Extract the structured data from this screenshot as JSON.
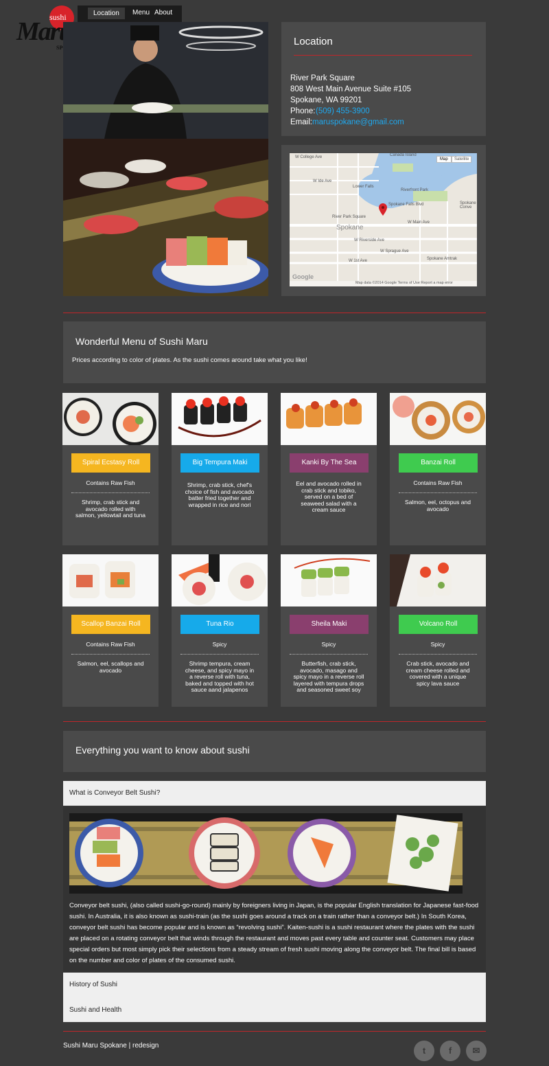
{
  "logo": {
    "sushi": "sushi",
    "maru": "Maru",
    "city": "SPOKANE"
  },
  "nav": {
    "items": [
      "Location",
      "Menu",
      "About"
    ]
  },
  "location": {
    "title": "Location",
    "line1": "River Park Square",
    "line2": "808 West Main Avenue Suite #105",
    "line3": "Spokane, WA 99201",
    "phone_label": "Phone:",
    "phone": "(509) 455-3900",
    "email_label": "Email:",
    "email": "maruspokane@gmail.com"
  },
  "map": {
    "btn_map": "Map",
    "btn_satellite": "Satellite",
    "labels": [
      "W College Ave",
      "Canada Island",
      "W Ide Ave",
      "Lower Falls",
      "Riverfront Park",
      "Spokane Falls Blvd",
      "River Park Square",
      "W Main Ave",
      "Spokane",
      "W Riverside Ave",
      "W Sprague Ave",
      "W 1st Ave",
      "Spokane Amtrak",
      "Spokane Conve"
    ],
    "footer": "Map data ©2014 Google   Terms of Use   Report a map error",
    "google": "Google"
  },
  "menu": {
    "title": "Wonderful Menu of Sushi Maru",
    "subtitle": "Prices according to color of plates. As the sushi comes around take what you like!",
    "items": [
      {
        "name": "Spiral Ecstasy Roll",
        "tag": "Contains Raw Fish",
        "desc": "Shrimp, crab stick and avocado rolled with salmon, yellowtail and tuna",
        "color": "#f5b620"
      },
      {
        "name": "Big Tempura Maki",
        "tag": "",
        "desc": "Shrimp, crab stick, chef's choice of fish and avocado batter fried together and wrapped in rice and nori",
        "color": "#16aaea"
      },
      {
        "name": "Kanki By The Sea",
        "tag": "",
        "desc": "Eel and avocado rolled in crab stick and tobiko, served on a bed of seaweed salad with a cream sauce",
        "color": "#8a3f6e"
      },
      {
        "name": "Banzai Roll",
        "tag": "Contains Raw Fish",
        "desc": "Salmon, eel, octopus and avocado",
        "color": "#3fcb4f"
      },
      {
        "name": "Scallop Banzai Roll",
        "tag": "Contains Raw Fish",
        "desc": "Salmon, eel, scallops and avocado",
        "color": "#f5b620"
      },
      {
        "name": "Tuna Rio",
        "tag": "Spicy",
        "desc": "Shrimp tempura, cream cheese, and spicy mayo in a reverse roll with tuna, baked and topped with hot sauce aand jalapenos",
        "color": "#16aaea"
      },
      {
        "name": "Sheila Maki",
        "tag": "Spicy",
        "desc": "Butterfish, crab stick, avocado, masago and spicy mayo in a reverse roll layered with tempura drops and seasoned sweet soy",
        "color": "#8a3f6e"
      },
      {
        "name": "Volcano Roll",
        "tag": "Spicy",
        "desc": "Crab stick, avocado and cream cheese rolled and covered with a unique spicy lava sauce",
        "color": "#3fcb4f"
      }
    ]
  },
  "faq": {
    "title": "Everything you want to know about sushi",
    "items": [
      "What is Conveyor Belt Sushi?",
      "History of Sushi",
      "Sushi and Health"
    ],
    "body": "Conveyor belt sushi, (also called sushi-go-round) mainly by foreigners living in Japan, is the popular English translation for Japanese fast-food sushi. In Australia, it is also known as sushi-train (as the sushi goes around a track on a train rather than a conveyor belt.) In South Korea, conveyor belt sushi has become popular and is known as “revolving sushi”. Kaiten-sushi is a sushi restaurant where the plates with the sushi are placed on a rotating conveyor belt that winds through the restaurant and moves past every table and counter seat. Customers may place special orders but most simply pick their selections from a steady stream of fresh sushi moving along the conveyor belt. The final bill is based on the number and color of plates of the consumed sushi."
  },
  "footer": {
    "text": "Sushi Maru Spokane | redesign"
  },
  "social": [
    {
      "icon": "twitter-icon",
      "glyph": "t"
    },
    {
      "icon": "facebook-icon",
      "glyph": "f"
    },
    {
      "icon": "email-icon",
      "glyph": "✉"
    }
  ]
}
